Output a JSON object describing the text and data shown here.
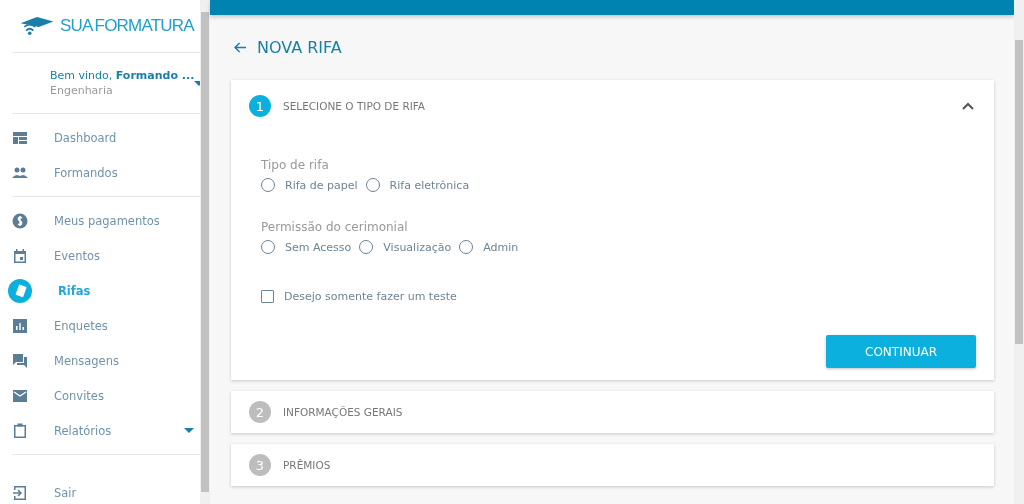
{
  "sidebar": {
    "logo": {
      "word_1": "SUA",
      "word_2": "FORMATURA"
    },
    "user": {
      "greeting": "Bem vindo,",
      "name": "Formando ...",
      "course": "Engenharia"
    },
    "groups": [
      [
        {
          "label": "Dashboard",
          "selected": false,
          "expandable": false
        },
        {
          "label": "Formandos",
          "selected": false,
          "expandable": false
        }
      ],
      [
        {
          "label": "Meus pagamentos",
          "selected": false,
          "expandable": false
        },
        {
          "label": "Eventos",
          "selected": false,
          "expandable": false
        },
        {
          "label": "Rifas",
          "selected": true,
          "expandable": false
        },
        {
          "label": "Enquetes",
          "selected": false,
          "expandable": false
        },
        {
          "label": "Mensagens",
          "selected": false,
          "expandable": false
        },
        {
          "label": "Convites",
          "selected": false,
          "expandable": false
        },
        {
          "label": "Relatórios",
          "selected": false,
          "expandable": true
        }
      ]
    ],
    "logout": {
      "label": "Sair"
    }
  },
  "page": {
    "title": "NOVA RIFA",
    "steps": [
      {
        "number": "1",
        "title": "SELECIONE O TIPO DE RIFA",
        "expanded": true
      },
      {
        "number": "2",
        "title": "INFORMAÇÕES GERAIS",
        "expanded": false
      },
      {
        "number": "3",
        "title": "PRÊMIOS",
        "expanded": false
      }
    ],
    "form": {
      "radio_groups": [
        {
          "label": "Tipo de rifa",
          "options": [
            {
              "label": "Rifa de papel",
              "selected": false
            },
            {
              "label": "Rifa eletrônica",
              "selected": false
            }
          ]
        },
        {
          "label": "Permissão do cerimonial",
          "options": [
            {
              "label": "Sem Acesso",
              "selected": false
            },
            {
              "label": "Visualização",
              "selected": false
            },
            {
              "label": "Admin",
              "selected": false
            }
          ]
        }
      ],
      "checkbox": {
        "label": "Desejo somente fazer um teste",
        "checked": false
      },
      "button": "CONTINUAR"
    }
  }
}
